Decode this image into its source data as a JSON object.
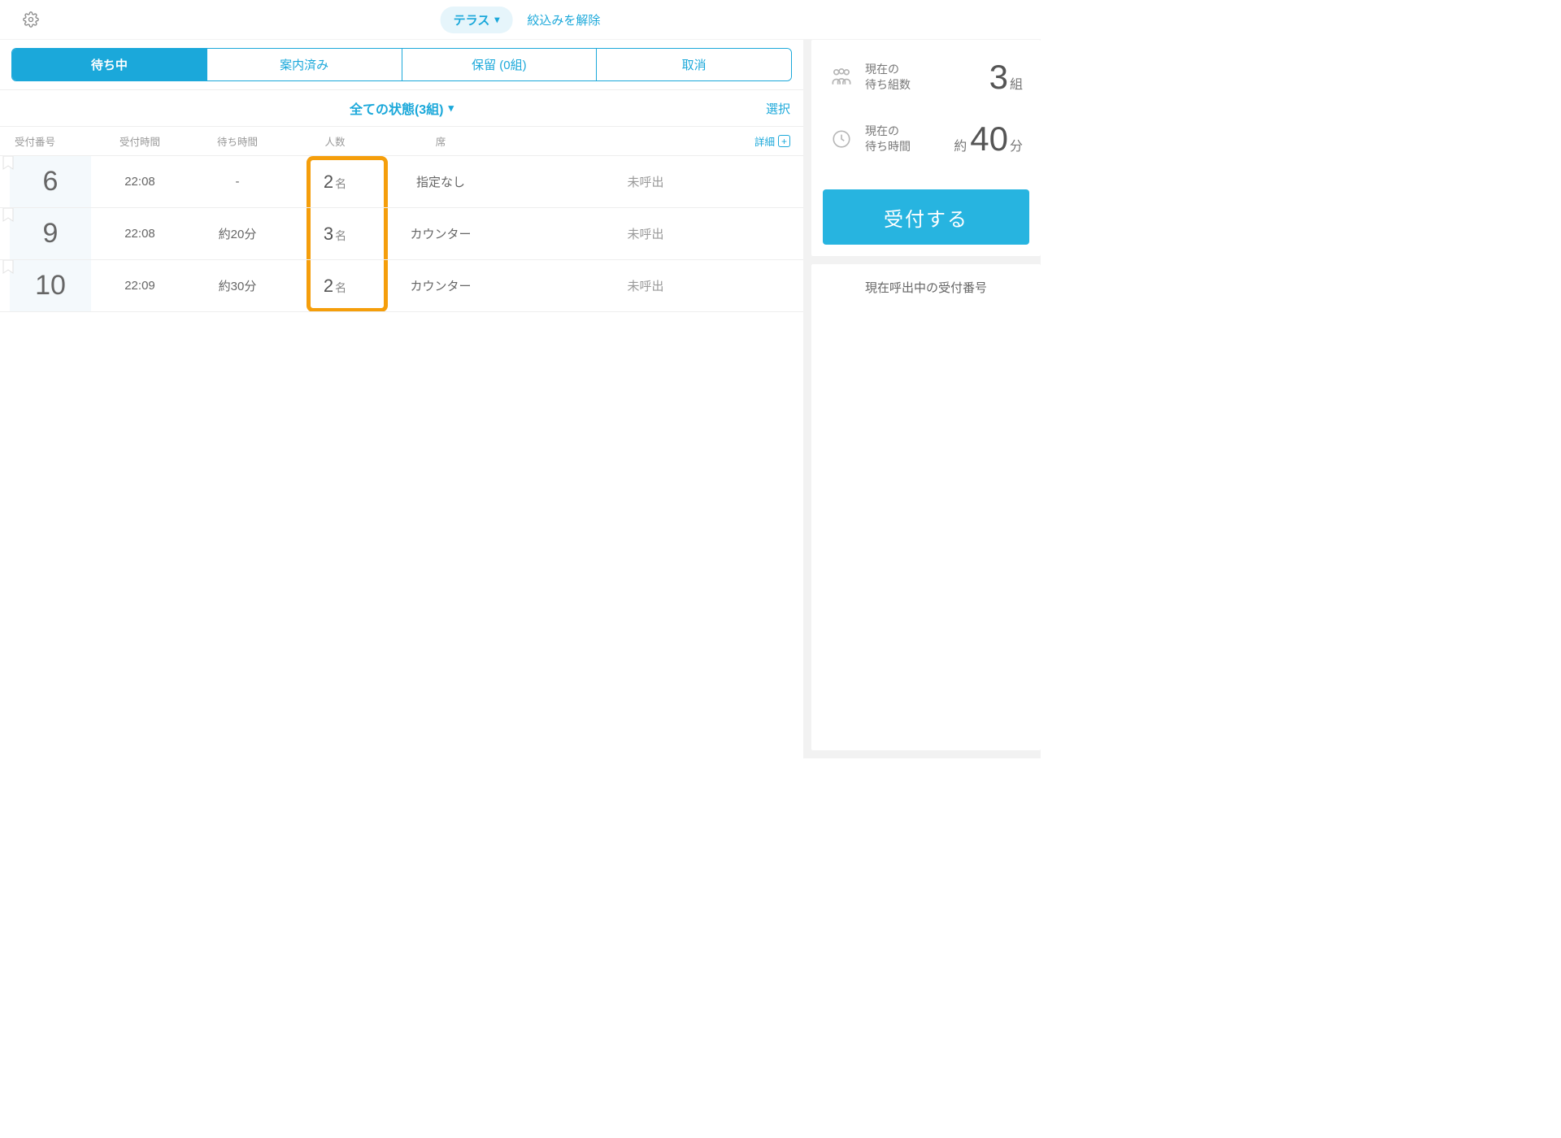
{
  "header": {
    "filter_label": "テラス",
    "clear_filter": "絞込みを解除"
  },
  "tabs": {
    "waiting": "待ち中",
    "guided": "案内済み",
    "hold": "保留 (0組)",
    "cancel": "取消"
  },
  "list": {
    "status_selector": "全ての状態(3組)",
    "select_action": "選択",
    "columns": {
      "number": "受付番号",
      "time": "受付時間",
      "wait": "待ち時間",
      "count": "人数",
      "seat": "席",
      "detail": "詳細"
    },
    "count_unit": "名",
    "rows": [
      {
        "num": "6",
        "time": "22:08",
        "wait": "-",
        "count": "2",
        "seat": "指定なし",
        "status": "未呼出"
      },
      {
        "num": "9",
        "time": "22:08",
        "wait": "約20分",
        "count": "3",
        "seat": "カウンター",
        "status": "未呼出"
      },
      {
        "num": "10",
        "time": "22:09",
        "wait": "約30分",
        "count": "2",
        "seat": "カウンター",
        "status": "未呼出"
      }
    ]
  },
  "side": {
    "wait_groups_label_l1": "現在の",
    "wait_groups_label_l2": "待ち組数",
    "wait_groups_value": "3",
    "wait_groups_unit": "組",
    "wait_time_label_l1": "現在の",
    "wait_time_label_l2": "待ち時間",
    "wait_time_prefix": "約",
    "wait_time_value": "40",
    "wait_time_unit": "分",
    "accept_button": "受付する",
    "calling_title": "現在呼出中の受付番号"
  }
}
